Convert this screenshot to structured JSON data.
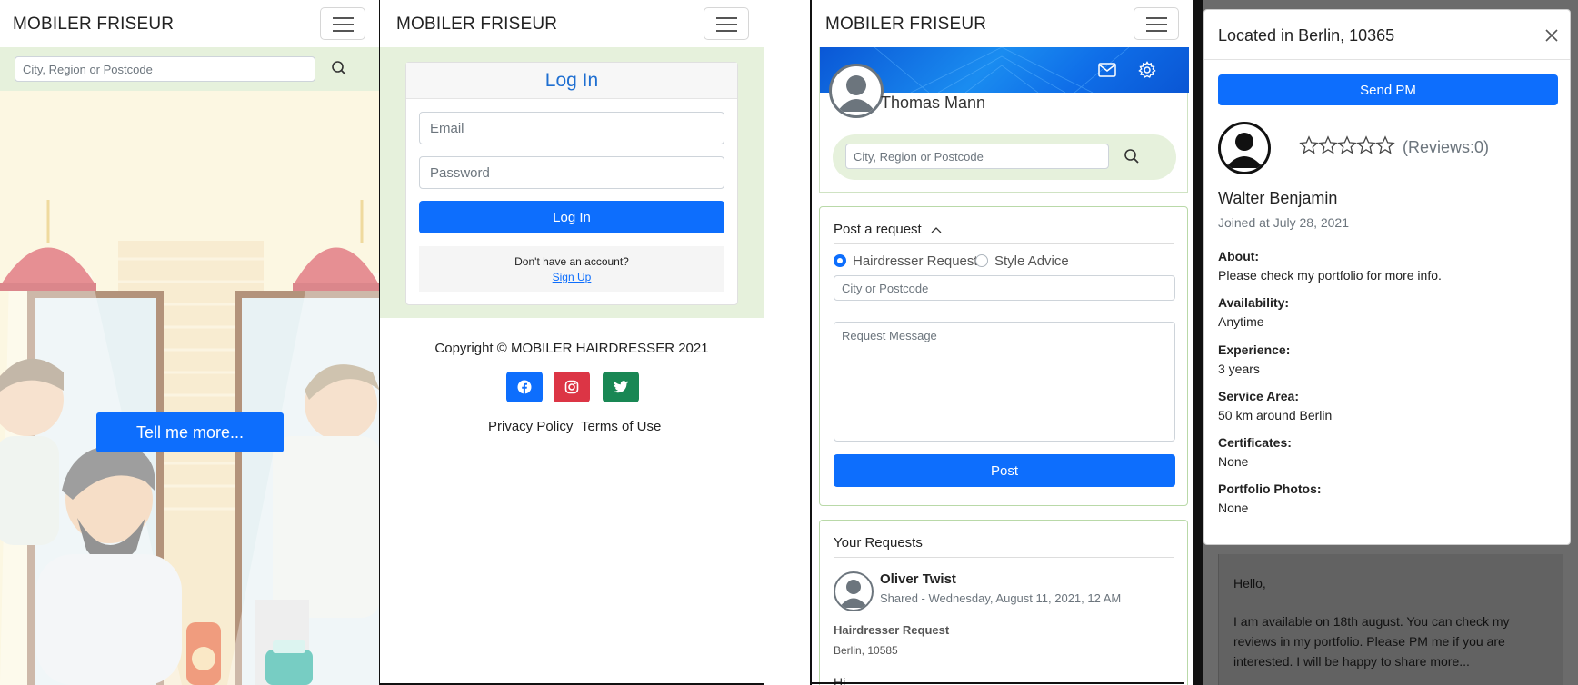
{
  "brand": "MOBILER FRISEUR",
  "screen1": {
    "search_placeholder": "City, Region or Postcode",
    "cta_label": "Tell me more..."
  },
  "screen2": {
    "title": "Log In",
    "email_placeholder": "Email",
    "password_placeholder": "Password",
    "login_button": "Log In",
    "no_account": "Don't have an account?",
    "signup_link": "Sign Up",
    "copyright": "Copyright © MOBILER HAIRDRESSER 2021",
    "privacy": "Privacy Policy",
    "terms": "Terms of Use",
    "social_colors": {
      "facebook": "#0d6efd",
      "instagram": "#dc3545",
      "twitter": "#198754"
    }
  },
  "screen3": {
    "user_name": "Thomas Mann",
    "search_placeholder": "City, Region or Postcode",
    "post_title": "Post a request",
    "radio_options": [
      "Hairdresser Request",
      "Style Advice"
    ],
    "city_placeholder": "City or Postcode",
    "message_placeholder": "Request Message",
    "post_button": "Post",
    "requests_title": "Your Requests",
    "request": {
      "name": "Oliver Twist",
      "shared": "Shared - Wednesday, August 11, 2021, 12 AM",
      "type": "Hairdresser Request",
      "location": "Berlin, 10585",
      "preview": "Hi"
    }
  },
  "screen4": {
    "title": "Located in Berlin, 10365",
    "send_pm": "Send PM",
    "reviews": "(Reviews:0)",
    "name": "Walter Benjamin",
    "joined": "Joined at July 28, 2021",
    "fields": [
      {
        "label": "About:",
        "value": "Please check my portfolio for more info."
      },
      {
        "label": "Availability:",
        "value": "Anytime"
      },
      {
        "label": "Experience:",
        "value": "3 years"
      },
      {
        "label": "Service Area:",
        "value": "50 km around Berlin"
      },
      {
        "label": "Certificates:",
        "value": "None"
      },
      {
        "label": "Portfolio Photos:",
        "value": "None"
      }
    ],
    "message_lines": [
      "Hello,",
      "",
      "I am available on 18th august. You can check my",
      "reviews in my portfolio. Please PM me if you are",
      "interested. I will be happy to share more..."
    ]
  },
  "colors": {
    "primary": "#0d6efd",
    "green_bg": "#e6f1dc",
    "heading_blue": "#1f6fd1"
  }
}
